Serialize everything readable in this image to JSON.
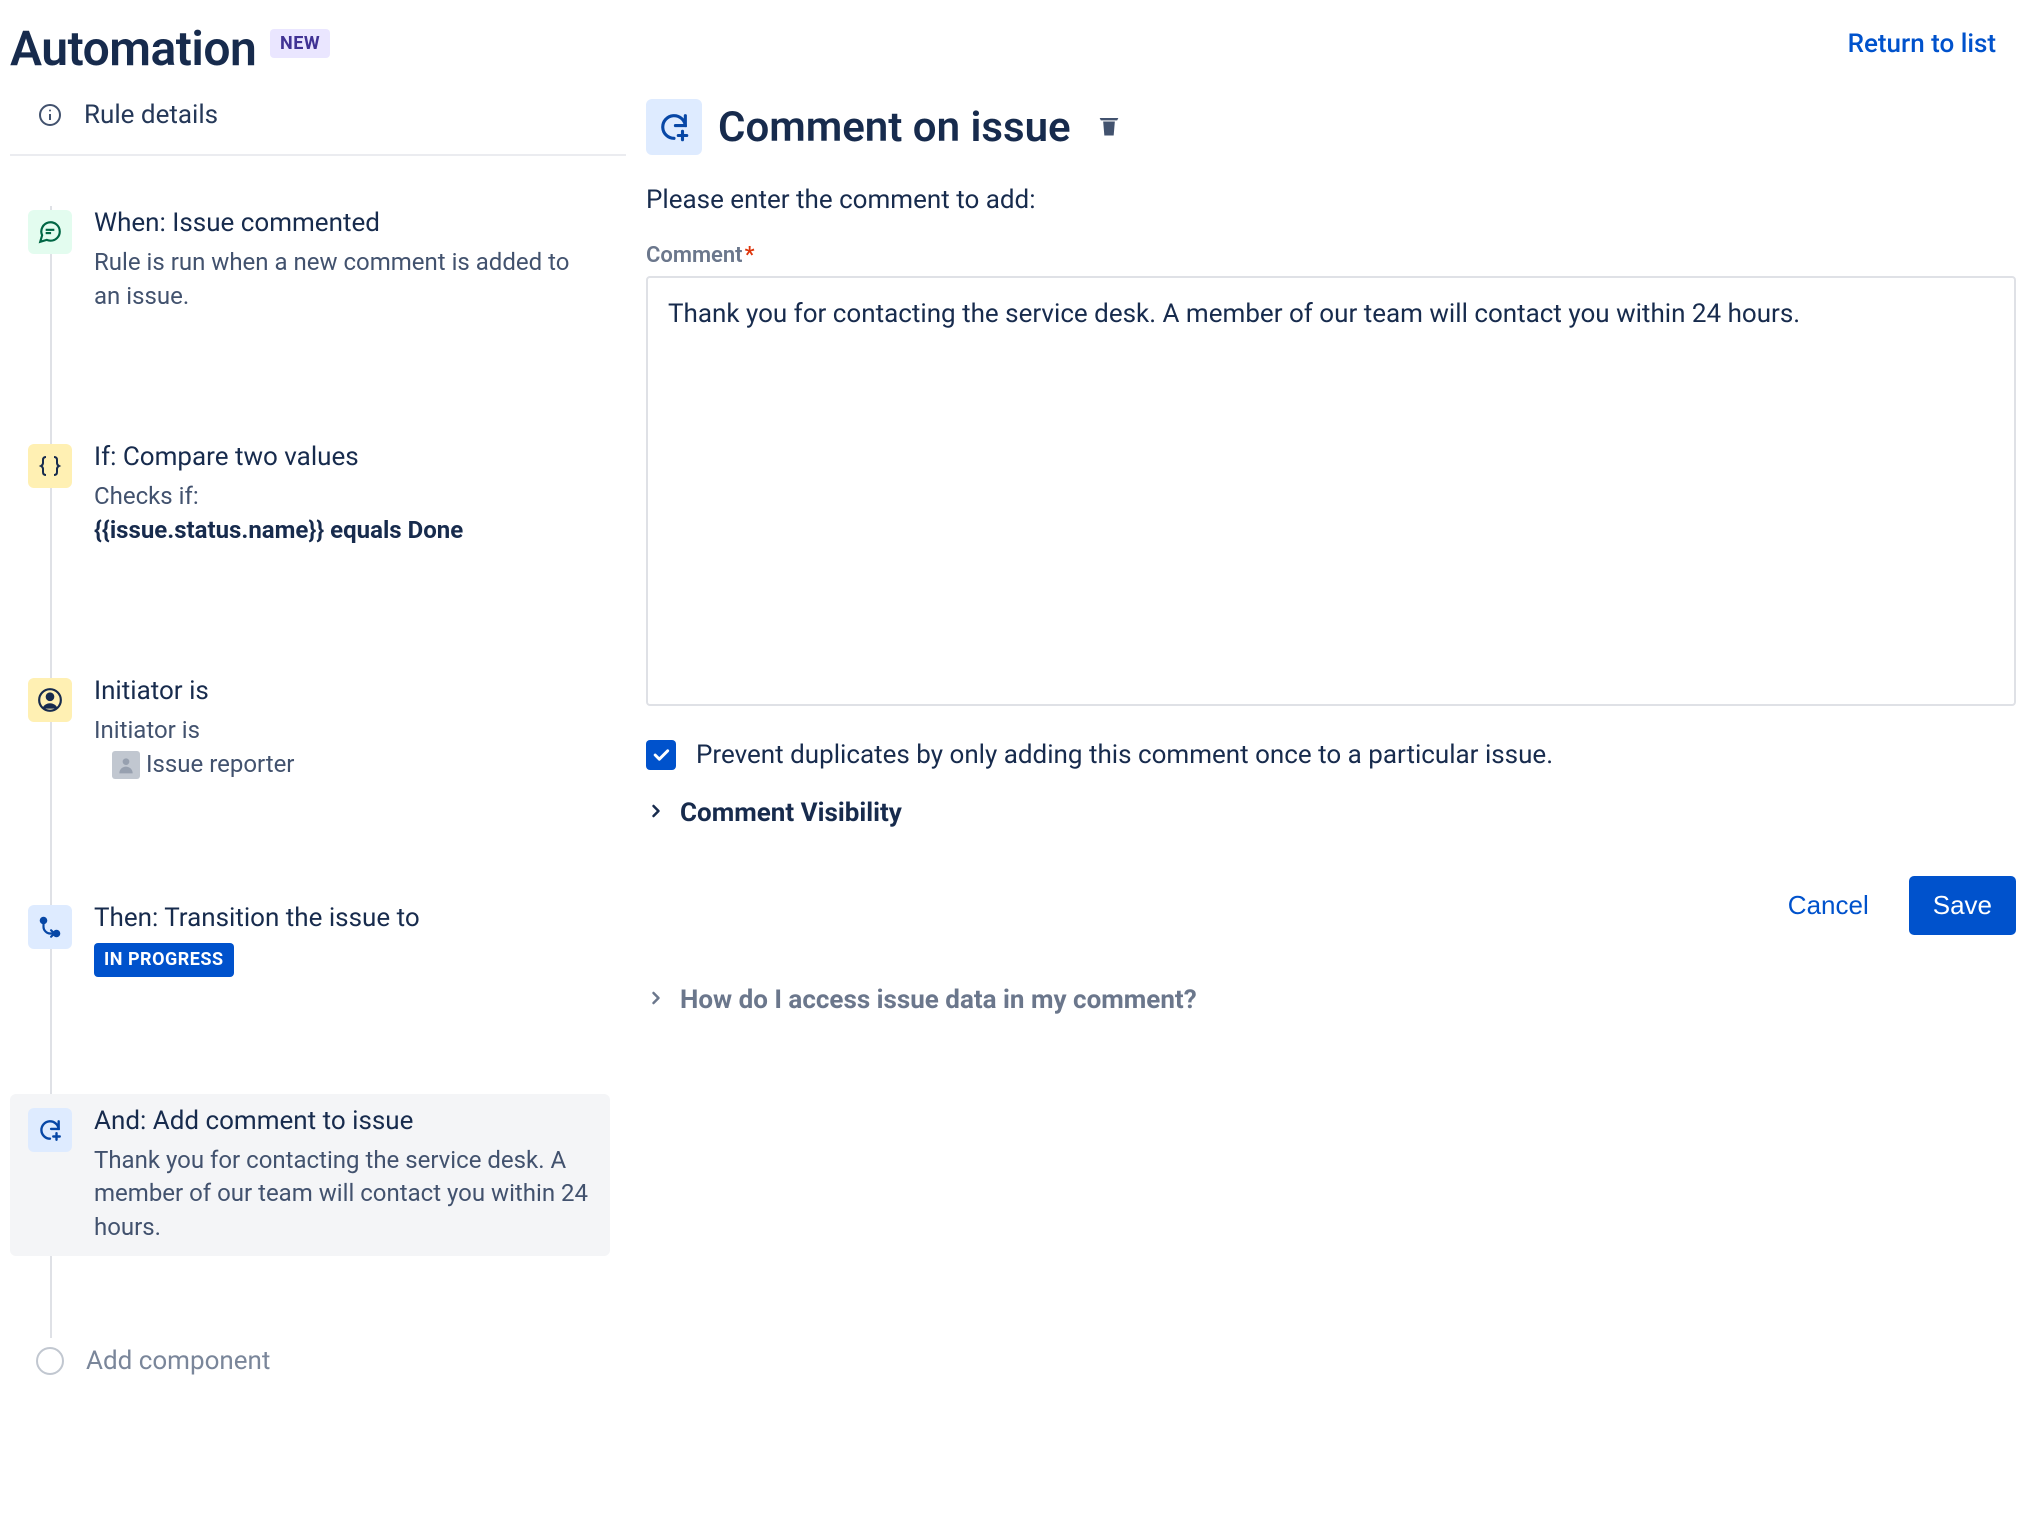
{
  "header": {
    "title": "Automation",
    "badge": "NEW",
    "return_link": "Return to list"
  },
  "sidebar": {
    "rule_details": "Rule details",
    "add_component": "Add component",
    "steps": [
      {
        "title": "When: Issue commented",
        "desc": "Rule is run when a new comment is added to an issue."
      },
      {
        "title": "If: Compare two values",
        "desc_pre": "Checks if:",
        "desc_bold": "{{issue.status.name}} equals Done"
      },
      {
        "title": "Initiator is",
        "desc_pre": "Initiator is",
        "desc_user": "Issue reporter"
      },
      {
        "title": "Then: Transition the issue to",
        "status_lozenge": "IN PROGRESS"
      },
      {
        "title": "And: Add comment to issue",
        "desc": "Thank you for contacting the service desk. A member of our team will contact you within 24 hours."
      }
    ]
  },
  "panel": {
    "title": "Comment on issue",
    "subtitle": "Please enter the comment to add:",
    "field_label": "Comment",
    "comment_value": "Thank you for contacting the service desk. A member of our team will contact you within 24 hours.",
    "prevent_duplicates_checked": true,
    "prevent_duplicates_label": "Prevent duplicates by only adding this comment once to a particular issue.",
    "visibility_label": "Comment Visibility",
    "cancel": "Cancel",
    "save": "Save",
    "help_label": "How do I access issue data in my comment?"
  }
}
